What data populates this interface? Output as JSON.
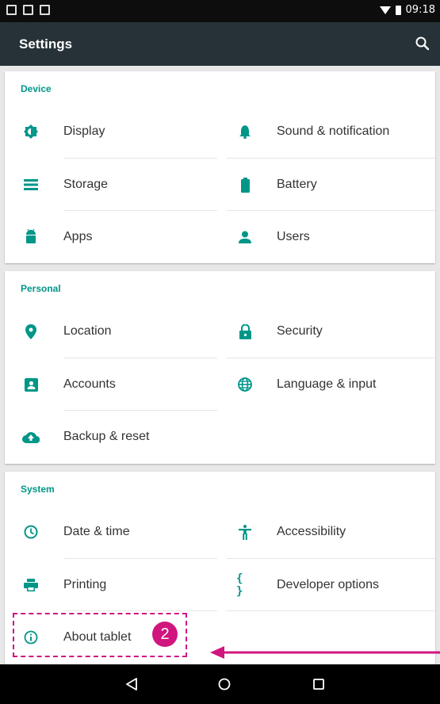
{
  "status": {
    "time": "09:18"
  },
  "appbar": {
    "title": "Settings",
    "search_icon": "search-icon"
  },
  "sections": {
    "device": {
      "title": "Device",
      "items": {
        "display": "Display",
        "sound": "Sound & notification",
        "storage": "Storage",
        "battery": "Battery",
        "apps": "Apps",
        "users": "Users"
      }
    },
    "personal": {
      "title": "Personal",
      "items": {
        "location": "Location",
        "security": "Security",
        "accounts": "Accounts",
        "language": "Language & input",
        "backup": "Backup & reset"
      }
    },
    "system": {
      "title": "System",
      "items": {
        "datetime": "Date & time",
        "accessibility": "Accessibility",
        "printing": "Printing",
        "developer": "Developer options",
        "about": "About tablet"
      }
    }
  },
  "annotation": {
    "badge": "2"
  },
  "colors": {
    "accent": "#009688",
    "appbar": "#263238",
    "annotation": "#d1157f"
  }
}
